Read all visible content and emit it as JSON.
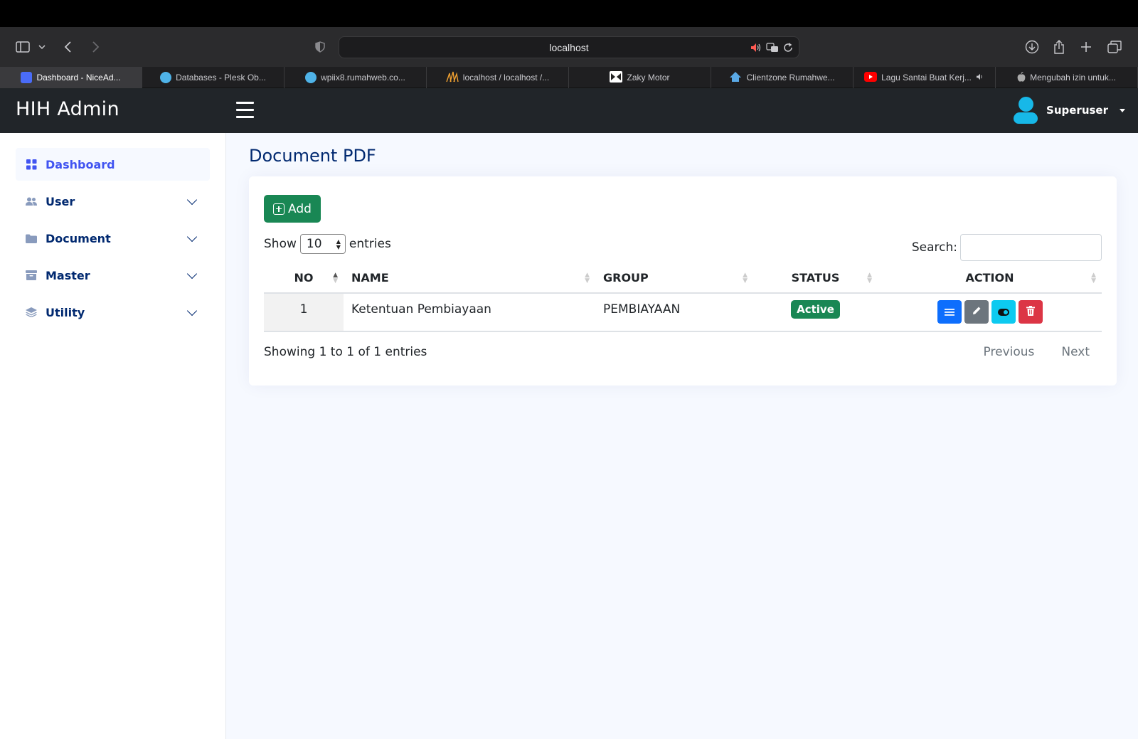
{
  "browser": {
    "url": "localhost",
    "tabs": [
      {
        "label": "Dashboard - NiceAd...",
        "icon": "niceadmin-favicon",
        "color": "#4a6cf7",
        "active": true
      },
      {
        "label": "Databases - Plesk Ob...",
        "icon": "globe-favicon",
        "color": "#4fb3e8",
        "active": false
      },
      {
        "label": "wpiix8.rumahweb.co...",
        "icon": "globe-favicon",
        "color": "#4fb3e8",
        "active": false
      },
      {
        "label": "localhost / localhost /...",
        "icon": "phpmyadmin-favicon",
        "color": "#f0a030",
        "active": false
      },
      {
        "label": "Zaky Motor",
        "icon": "zaky-favicon",
        "color": "#ffffff",
        "active": false
      },
      {
        "label": "Clientzone Rumahwe...",
        "icon": "rumahweb-favicon",
        "color": "#5aa9e6",
        "active": false
      },
      {
        "label": "Lagu Santai Buat Kerj...",
        "icon": "youtube-favicon",
        "color": "#ff0000",
        "active": false
      },
      {
        "label": "Mengubah izin untuk...",
        "icon": "apple-favicon",
        "color": "#aaaaaa",
        "active": false
      }
    ]
  },
  "app": {
    "brand": "HIH Admin",
    "user_name": "Superuser"
  },
  "sidebar": {
    "items": [
      {
        "label": "Dashboard",
        "icon": "grid-icon",
        "active": true,
        "has_chevron": false
      },
      {
        "label": "User",
        "icon": "people-icon",
        "active": false,
        "has_chevron": true
      },
      {
        "label": "Document",
        "icon": "folder-icon",
        "active": false,
        "has_chevron": true
      },
      {
        "label": "Master",
        "icon": "archive-icon",
        "active": false,
        "has_chevron": true
      },
      {
        "label": "Utility",
        "icon": "layers-icon",
        "active": false,
        "has_chevron": true
      }
    ]
  },
  "page": {
    "title": "Document PDF",
    "add_label": "Add",
    "show_label": "Show",
    "entries_value": "10",
    "entries_label": "entries",
    "search_label": "Search:",
    "columns": [
      "NO",
      "NAME",
      "GROUP",
      "STATUS",
      "ACTION"
    ],
    "rows": [
      {
        "no": "1",
        "name": "Ketentuan Pembiayaan",
        "group": "PEMBIAYAAN",
        "status": "Active"
      }
    ],
    "info": "Showing 1 to 1 of 1 entries",
    "prev_label": "Previous",
    "next_label": "Next",
    "action_colors": {
      "view": "#0d6efd",
      "edit": "#6c757d",
      "toggle": "#0dcaf0",
      "delete": "#dc3545"
    }
  }
}
